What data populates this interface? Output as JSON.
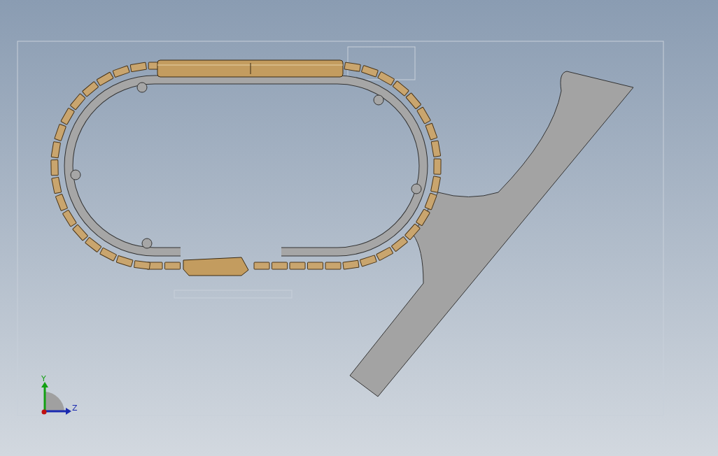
{
  "triad": {
    "y_label": "Y",
    "z_label": "Z"
  }
}
